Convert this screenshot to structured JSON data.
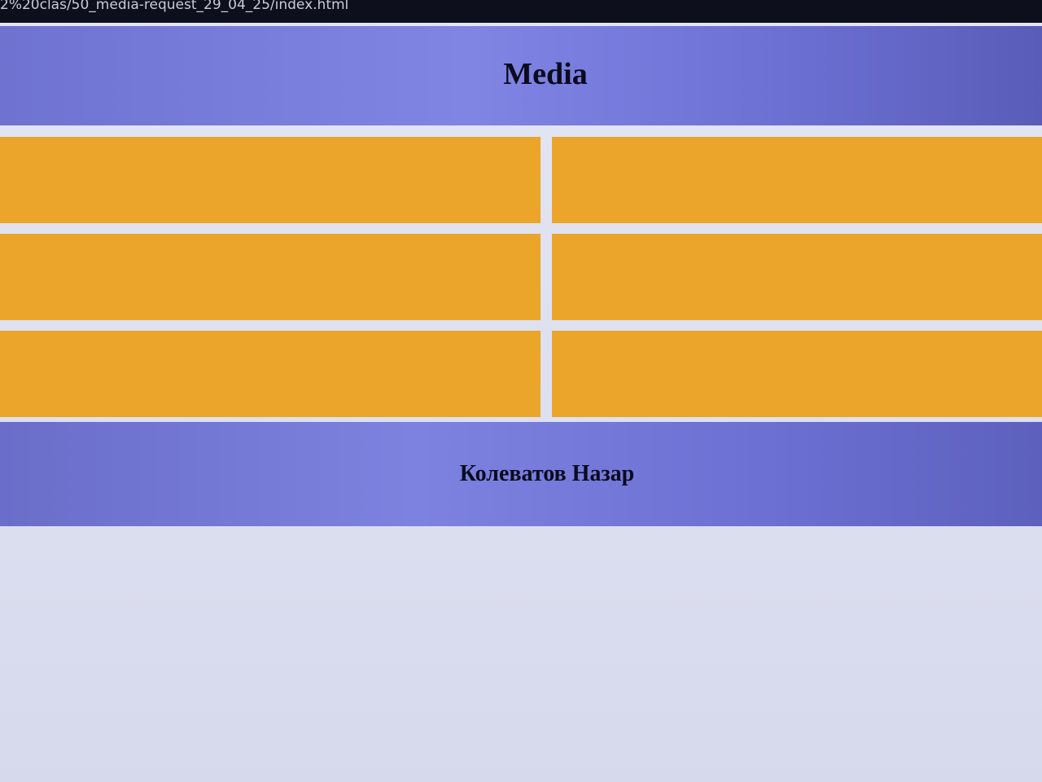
{
  "browser": {
    "address": "2%20clas/50_media-request_29_04_25/index.html"
  },
  "header": {
    "title": "Media"
  },
  "grid": {
    "rows": 3,
    "columns": 2
  },
  "footer": {
    "author": "Колеватов Назар"
  },
  "colors": {
    "header_bg": "#7f84e2",
    "cell_bg": "#eaa52a",
    "page_bg": "#dde0ef",
    "text": "#0b0b1e"
  }
}
